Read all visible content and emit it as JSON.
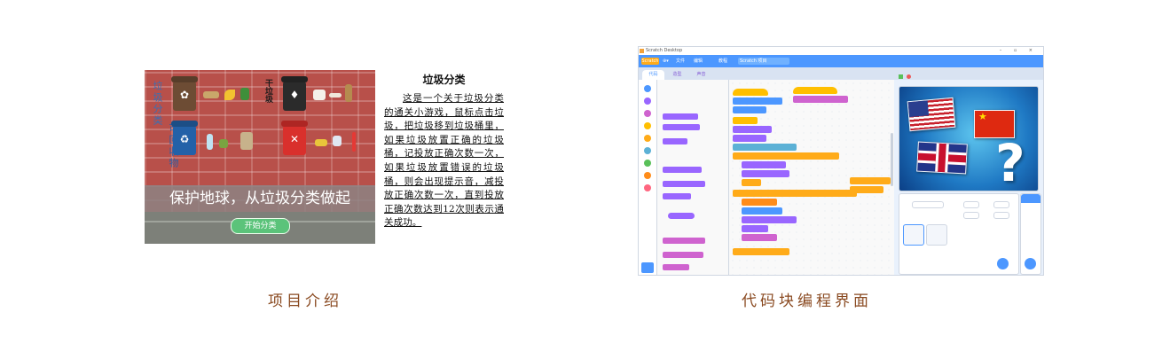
{
  "left_panel": {
    "game_preview": {
      "pole_text_1": "垃圾分类",
      "pole_text_2": "可回收物",
      "bin_label_dry": "干垃圾",
      "banner": "保护地球，从垃圾分类做起",
      "start_button": "开始分类"
    },
    "description": {
      "title": "垃圾分类",
      "body": "这是一个关于垃圾分类的通关小游戏，鼠标点击垃圾，把垃圾移到垃圾桶里，如果垃圾放置正确的垃圾桶，记投放正确次数一次，如果垃圾放置错误的垃圾桶，则会出现提示音，减投放正确次数一次，直到投放正确次数达到12次则表示通关成功。"
    },
    "caption": "项目介绍"
  },
  "right_panel": {
    "window_title": "Scratch Desktop",
    "window_controls": "–  ▫  ×",
    "menu": {
      "logo": "Scratch",
      "items": [
        "文件",
        "编辑",
        "教程"
      ],
      "project_name": "Scratch 项目"
    },
    "tabs": [
      "代码",
      "造型",
      "声音"
    ],
    "caption": "代码块编程界面"
  },
  "colors": {
    "caption": "#8a4a21",
    "scratch_blue": "#4c97ff",
    "motion": "#4c97ff",
    "looks": "#9966ff",
    "sound": "#cf63cf",
    "events": "#ffbf00",
    "control": "#ffab19",
    "sensing": "#5cb1d6",
    "operators": "#59c059",
    "variables": "#ff8c1a",
    "my_blocks": "#ff6680"
  }
}
